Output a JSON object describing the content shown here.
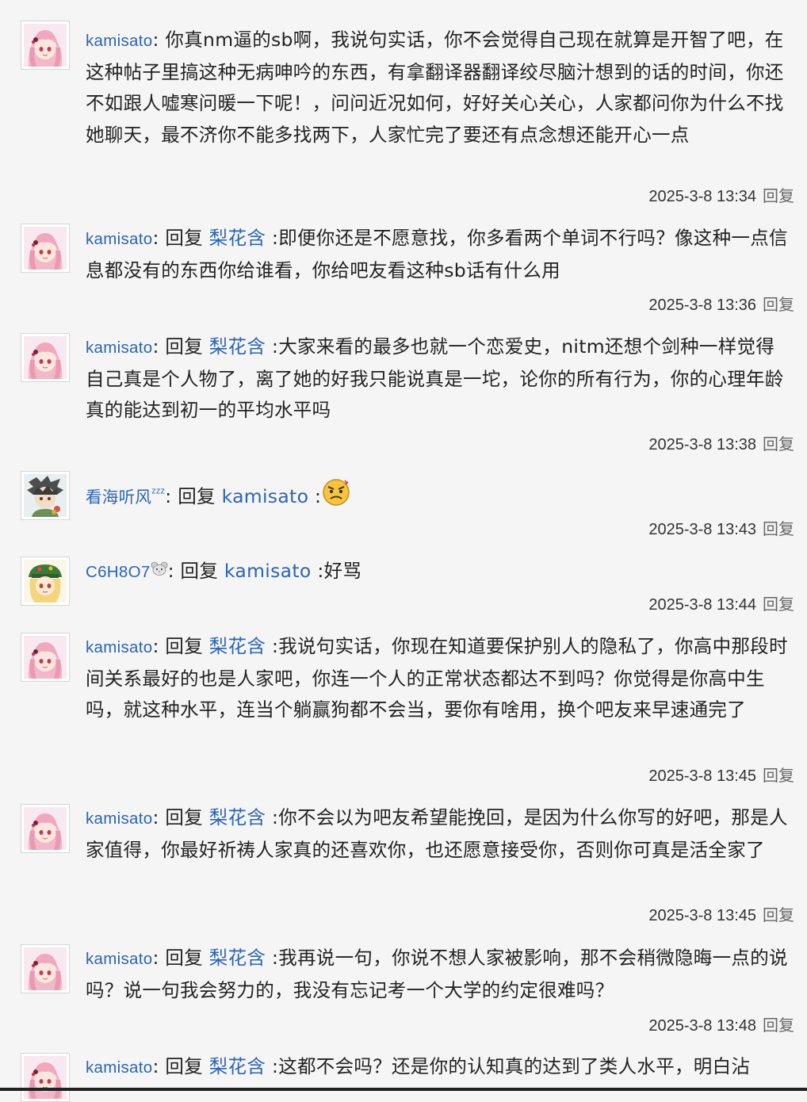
{
  "comments": [
    {
      "user": "kamisato",
      "sep": ":",
      "text": " 你真nm逼的sb啊，我说句实话，你不会觉得自己现在就算是开智了吧，在这种帖子里搞这种无病呻吟的东西，有拿翻译器翻译绞尽脑汁想到的话的时间，你还不如跟人嘘寒问暖一下呢！，问问近况如何，好好关心关心，人家都问你为什么不找她聊天，最不济你不能多找两下，人家忙完了要还有点念想还能开心一点",
      "time": "2025-3-8 13:34",
      "reply": "回复"
    },
    {
      "user": "kamisato",
      "sep": ":",
      "reply_prefix": " 回复 ",
      "reply_to": "梨花含",
      "text": " :即便你还是不愿意找，你多看两个单词不行吗？像这种一点信息都没有的东西你给谁看，你给吧友看这种sb话有什么用",
      "time": "2025-3-8 13:36",
      "reply": "回复"
    },
    {
      "user": "kamisato",
      "sep": ":",
      "reply_prefix": " 回复 ",
      "reply_to": "梨花含",
      "text": " :大家来看的最多也就一个恋爱史，nitm还想个剑种一样觉得自己真是个人物了，离了她的好我只能说真是一坨，论你的所有行为，你的心理年龄真的能达到初一的平均水平吗",
      "time": "2025-3-8 13:38",
      "reply": "回复"
    },
    {
      "user": "看海听风",
      "user_suffix": "ᶻᶻᶻ",
      "sep": ":",
      "reply_prefix": " 回复 ",
      "reply_to": "kamisato",
      "text": " :",
      "time": "2025-3-8 13:43",
      "reply": "回复"
    },
    {
      "user": "C6H8O7",
      "sep": ":",
      "reply_prefix": " 回复 ",
      "reply_to": "kamisato",
      "text": " :好骂",
      "time": "2025-3-8 13:44",
      "reply": "回复"
    },
    {
      "user": "kamisato",
      "sep": ":",
      "reply_prefix": " 回复 ",
      "reply_to": "梨花含",
      "text": " :我说句实话，你现在知道要保护别人的隐私了，你高中那段时间关系最好的也是人家吧，你连一个人的正常状态都达不到吗？你觉得是你高中生吗，就这种水平，连当个躺赢狗都不会当，要你有啥用，换个吧友来早速通完了",
      "time": "2025-3-8 13:45",
      "reply": "回复"
    },
    {
      "user": "kamisato",
      "sep": ":",
      "reply_prefix": " 回复 ",
      "reply_to": "梨花含",
      "text": " :你不会以为吧友希望能挽回，是因为什么你写的好吧，那是人家值得，你最好祈祷人家真的还喜欢你，也还愿意接受你，否则你可真是活全家了",
      "time": "2025-3-8 13:45",
      "reply": "回复"
    },
    {
      "user": "kamisato",
      "sep": ":",
      "reply_prefix": " 回复 ",
      "reply_to": "梨花含",
      "text": " :我再说一句，你说不想人家被影响，那不会稍微隐晦一点的说吗？说一句我会努力的，我没有忘记考一个大学的约定很难吗？",
      "time": "2025-3-8 13:48",
      "reply": "回复"
    },
    {
      "user": "kamisato",
      "sep": ":",
      "reply_prefix": " 回复 ",
      "reply_to": "梨花含",
      "text": " :这都不会吗？还是你的认知真的达到了类人水平，明白沾",
      "time": "",
      "reply": ""
    }
  ],
  "colors": {
    "link": "#2d64b3",
    "text": "#222222",
    "meta": "#333333",
    "background": "#f5f5f5"
  },
  "icons": {
    "face_emoji": "angry-face-emoji-icon",
    "mouse_emoji": "mouse-emoji-icon"
  }
}
